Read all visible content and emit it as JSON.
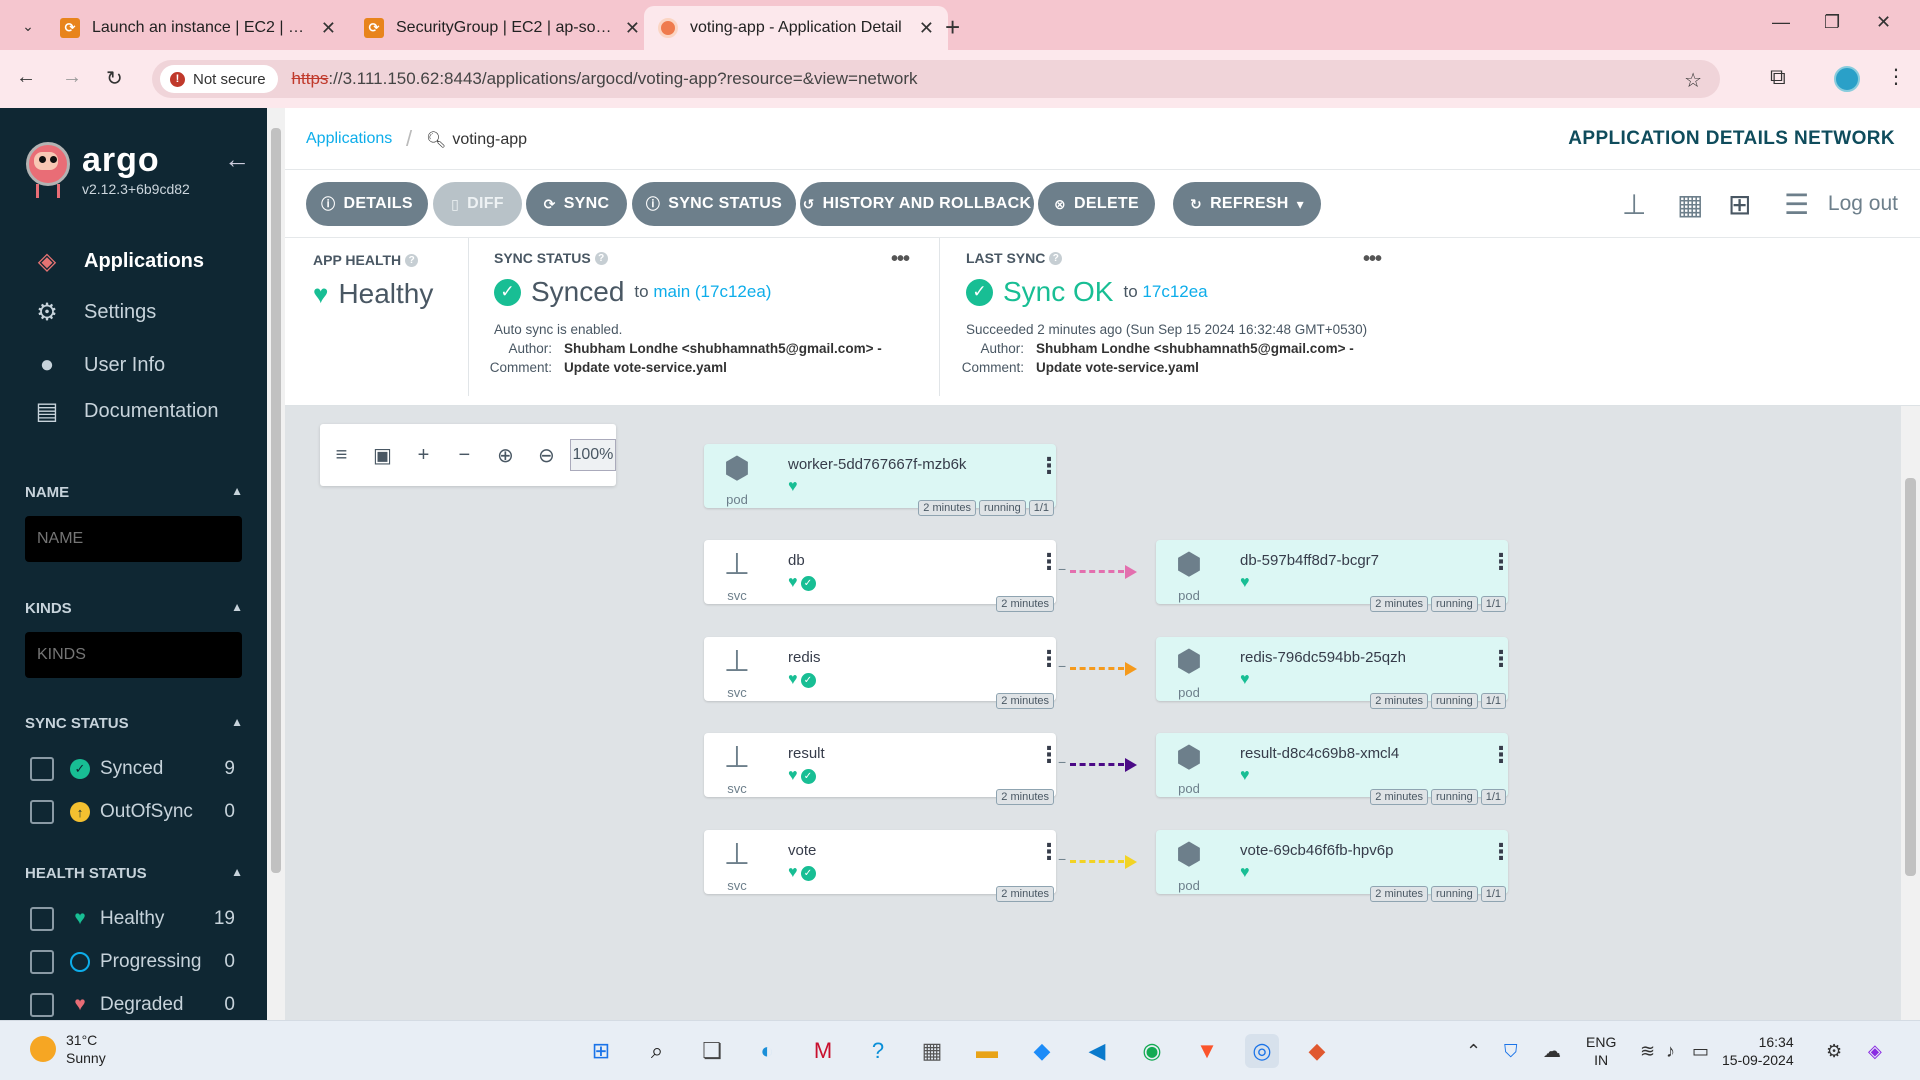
{
  "browser": {
    "tabs": [
      {
        "title": "Launch an instance | EC2 | ap-so",
        "favicon": "aws-icon"
      },
      {
        "title": "SecurityGroup | EC2 | ap-south-",
        "favicon": "aws-icon"
      },
      {
        "title": "voting-app - Application Detail",
        "favicon": "argo-icon"
      }
    ],
    "not_secure_label": "Not secure",
    "url_scheme": "https",
    "url_rest": "://3.111.150.62:8443/applications/argocd/voting-app?resource=&view=network"
  },
  "sidebar": {
    "brand": "argo",
    "version": "v2.12.3+6b9cd82",
    "nav": [
      {
        "label": "Applications",
        "icon": "layers-icon"
      },
      {
        "label": "Settings",
        "icon": "gear-icon"
      },
      {
        "label": "User Info",
        "icon": "user-icon"
      },
      {
        "label": "Documentation",
        "icon": "document-icon"
      }
    ],
    "name_filter": {
      "title": "NAME",
      "placeholder": "NAME"
    },
    "kinds_filter": {
      "title": "KINDS",
      "placeholder": "KINDS"
    },
    "sync_status": {
      "title": "SYNC STATUS",
      "items": [
        {
          "label": "Synced",
          "count": "9",
          "color": "#18be94"
        },
        {
          "label": "OutOfSync",
          "count": "0",
          "color": "#f4c030"
        }
      ]
    },
    "health_status": {
      "title": "HEALTH STATUS",
      "items": [
        {
          "label": "Healthy",
          "count": "19",
          "color": "#18be94"
        },
        {
          "label": "Progressing",
          "count": "0",
          "color": "#0dadea"
        },
        {
          "label": "Degraded",
          "count": "0",
          "color": "#e96d76"
        }
      ]
    }
  },
  "header": {
    "breadcrumb_root": "Applications",
    "breadcrumb_app": "voting-app",
    "page_title": "APPLICATION DETAILS NETWORK",
    "logout": "Log out"
  },
  "toolbar": {
    "details": "DETAILS",
    "diff": "DIFF",
    "sync": "SYNC",
    "sync_status": "SYNC STATUS",
    "history": "HISTORY AND ROLLBACK",
    "delete": "DELETE",
    "refresh": "REFRESH"
  },
  "status": {
    "app_health": {
      "title": "APP HEALTH",
      "value": "Healthy"
    },
    "sync": {
      "title": "SYNC STATUS",
      "value": "Synced",
      "to_prefix": "to",
      "target": "main (17c12ea)",
      "auto": "Auto sync is enabled.",
      "author_label": "Author:",
      "author": "Shubham Londhe <shubhamnath5@gmail.com> -",
      "comment_label": "Comment:",
      "comment": "Update vote-service.yaml"
    },
    "last_sync": {
      "title": "LAST SYNC",
      "value": "Sync OK",
      "to_prefix": "to",
      "target": "17c12ea",
      "succeeded": "Succeeded 2 minutes ago (Sun Sep 15 2024 16:32:48 GMT+0530)",
      "author_label": "Author:",
      "author": "Shubham Londhe <shubhamnath5@gmail.com> -",
      "comment_label": "Comment:",
      "comment": "Update vote-service.yaml"
    }
  },
  "graph": {
    "zoom": "100%",
    "worker": {
      "name": "worker-5dd767667f-mzb6k",
      "kind": "pod",
      "age": "2 minutes",
      "state": "running",
      "ready": "1/1"
    },
    "rows": [
      {
        "svc": {
          "name": "db",
          "kind": "svc",
          "age": "2 minutes"
        },
        "pod": {
          "name": "db-597b4ff8d7-bcgr7",
          "kind": "pod",
          "age": "2 minutes",
          "state": "running",
          "ready": "1/1"
        },
        "edge_color": "#e36fae"
      },
      {
        "svc": {
          "name": "redis",
          "kind": "svc",
          "age": "2 minutes"
        },
        "pod": {
          "name": "redis-796dc594bb-25qzh",
          "kind": "pod",
          "age": "2 minutes",
          "state": "running",
          "ready": "1/1"
        },
        "edge_color": "#f59a1c"
      },
      {
        "svc": {
          "name": "result",
          "kind": "svc",
          "age": "2 minutes"
        },
        "pod": {
          "name": "result-d8c4c69b8-xmcl4",
          "kind": "pod",
          "age": "2 minutes",
          "state": "running",
          "ready": "1/1"
        },
        "edge_color": "#4b0a86"
      },
      {
        "svc": {
          "name": "vote",
          "kind": "svc",
          "age": "2 minutes"
        },
        "pod": {
          "name": "vote-69cb46f6fb-hpv6p",
          "kind": "pod",
          "age": "2 minutes",
          "state": "running",
          "ready": "1/1"
        },
        "edge_color": "#f2d324"
      }
    ]
  },
  "taskbar": {
    "temp": "31°C",
    "weather": "Sunny",
    "lang": "ENG",
    "region": "IN",
    "time": "16:34",
    "date": "15-09-2024"
  }
}
